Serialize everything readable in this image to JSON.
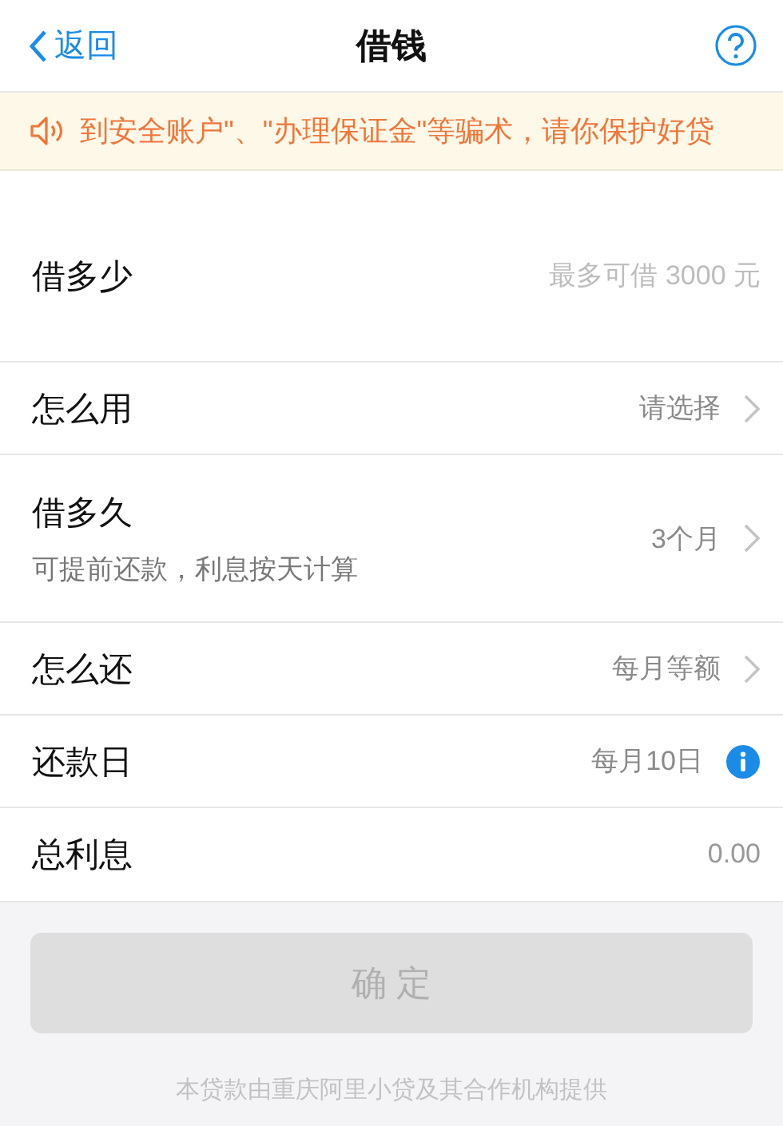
{
  "header": {
    "back": "返回",
    "title": "借钱"
  },
  "notice": {
    "text": "到安全账户\"、\"办理保证金\"等骗术，请你保护好贷"
  },
  "rows": [
    {
      "kind": "input",
      "label": "借多少",
      "placeholder": "最多可借 3000 元"
    },
    {
      "kind": "select",
      "label": "怎么用",
      "value": "请选择"
    },
    {
      "kind": "select",
      "label": "借多久",
      "note": "可提前还款，利息按天计算",
      "value": "3个月"
    },
    {
      "kind": "select",
      "label": "怎么还",
      "value": "每月等额"
    },
    {
      "kind": "info",
      "label": "还款日",
      "value": "每月10日"
    },
    {
      "kind": "plain",
      "label": "总利息",
      "value": "0.00"
    }
  ],
  "confirm": {
    "label": "确 定",
    "disabled": true
  },
  "footer": "本贷款由重庆阿里小贷及其合作机构提供"
}
